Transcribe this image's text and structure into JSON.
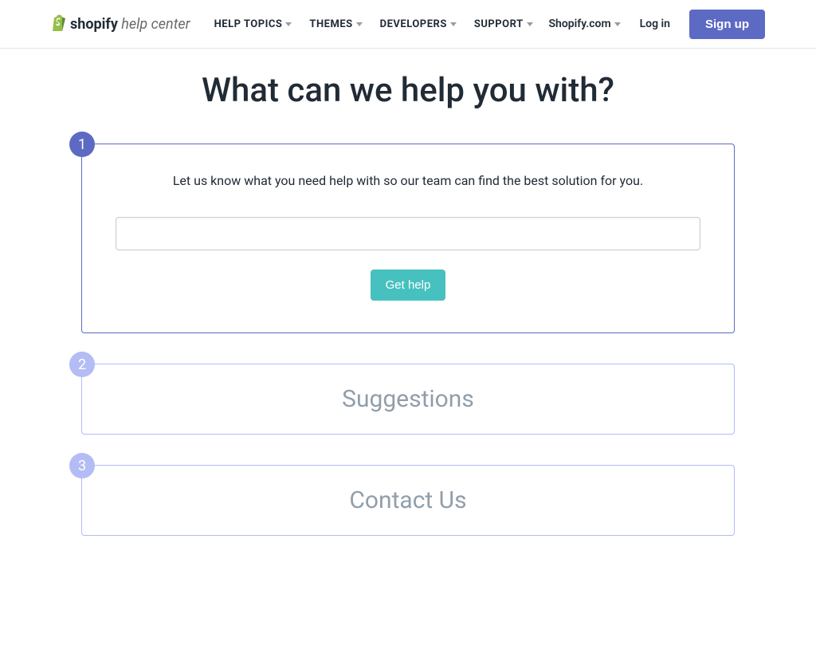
{
  "header": {
    "logo_bold": "shopify",
    "logo_light": " help center",
    "nav": [
      {
        "label": "HELP TOPICS"
      },
      {
        "label": "THEMES"
      },
      {
        "label": "DEVELOPERS"
      },
      {
        "label": "SUPPORT"
      }
    ],
    "right": {
      "shopify_link": "Shopify.com",
      "login": "Log in",
      "signup": "Sign up"
    }
  },
  "main": {
    "title": "What can we help you with?",
    "step1": {
      "number": "1",
      "prompt": "Let us know what you need help with so our team can find the best solution for you.",
      "input_value": "",
      "button": "Get help"
    },
    "step2": {
      "number": "2",
      "title": "Suggestions"
    },
    "step3": {
      "number": "3",
      "title": "Contact Us"
    }
  }
}
